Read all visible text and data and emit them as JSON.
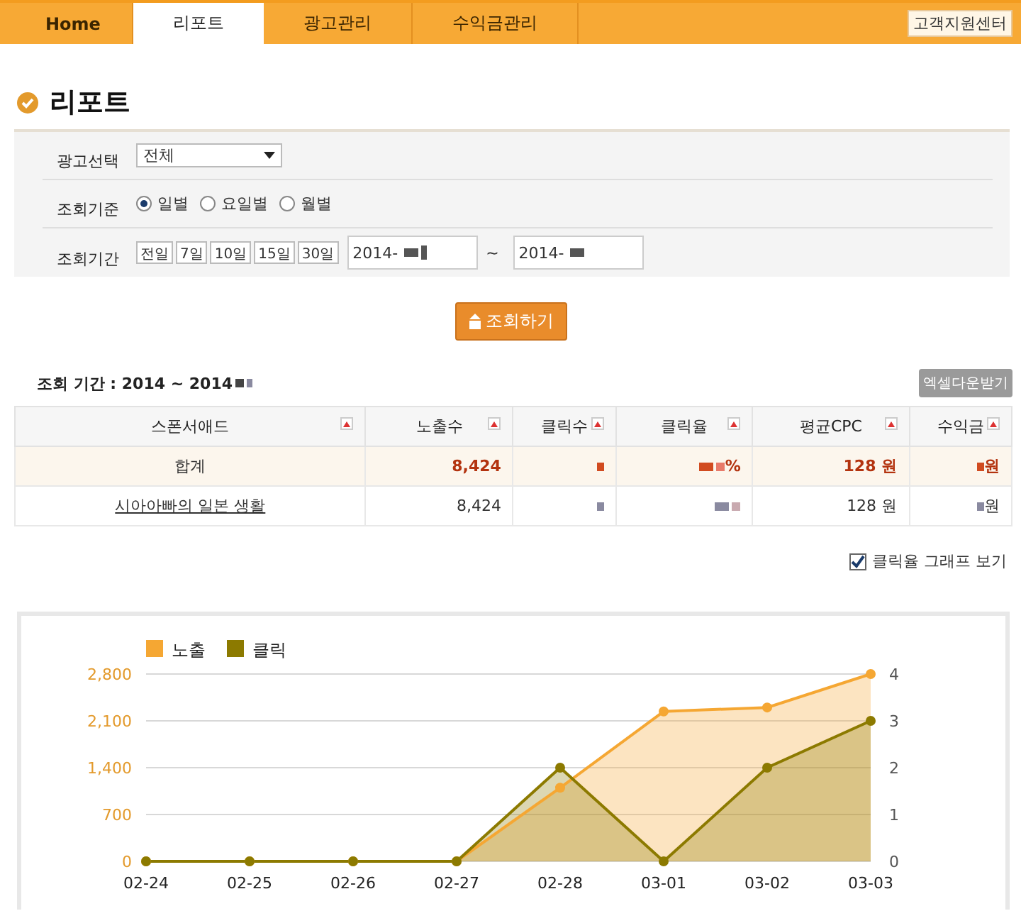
{
  "nav": {
    "tabs": [
      {
        "label": "Home",
        "selected": false
      },
      {
        "label": "리포트",
        "selected": true
      },
      {
        "label": "광고관리",
        "selected": false
      },
      {
        "label": "수익금관리",
        "selected": false
      }
    ],
    "support_button": "고객지원센터"
  },
  "title": "리포트",
  "filters": {
    "ad_select": {
      "label": "광고선택",
      "value": "전체"
    },
    "basis": {
      "label": "조회기준",
      "options": [
        {
          "label": "일별",
          "selected": true
        },
        {
          "label": "요일별",
          "selected": false
        },
        {
          "label": "월별",
          "selected": false
        }
      ]
    },
    "period": {
      "label": "조회기간",
      "presets": [
        "전일",
        "7일",
        "10일",
        "15일",
        "30일"
      ],
      "from": {
        "value": "2014-",
        "redacted": true
      },
      "separator": "~",
      "to": {
        "value": "2014-",
        "redacted": true
      }
    }
  },
  "search_button": "조회하기",
  "summary": {
    "label": "조회 기간 : 2014",
    "separator": "~ 2014",
    "redacted": true
  },
  "excel_button": "엑셀다운받기",
  "table": {
    "columns": [
      "스폰서애드",
      "노출수",
      "클릭수",
      "클릭율",
      "평균CPC",
      "수익금"
    ],
    "rows": [
      {
        "kind": "total",
        "cells": [
          {
            "text": "합계",
            "redacted": false
          },
          {
            "text": "8,424",
            "redacted": false
          },
          {
            "redacted": true
          },
          {
            "text": "%",
            "redacted": true
          },
          {
            "text": "128 원",
            "redacted": false
          },
          {
            "text": "원",
            "redacted": true
          }
        ]
      },
      {
        "kind": "link",
        "cells": [
          {
            "text": "시아아빠의 일본 생활",
            "redacted": false
          },
          {
            "text": "8,424",
            "redacted": false
          },
          {
            "redacted": true
          },
          {
            "redacted": true
          },
          {
            "text": "128 원",
            "redacted": false
          },
          {
            "text": "원",
            "redacted": true
          }
        ]
      }
    ]
  },
  "graph_toggle": {
    "label": "클릭율 그래프 보기",
    "checked": true
  },
  "chart": {
    "chart_data": {
      "type": "area",
      "categories": [
        "02-24",
        "02-25",
        "02-26",
        "02-27",
        "02-28",
        "03-01",
        "03-02",
        "03-03"
      ],
      "series": [
        {
          "name": "노출",
          "color": "#f5a733",
          "values": [
            0,
            0,
            0,
            0,
            1100,
            2240,
            2300,
            2800
          ]
        },
        {
          "name": "클릭",
          "color": "#8c7a00",
          "axis": "y2",
          "values": [
            0,
            0,
            0,
            0,
            2,
            0,
            2,
            3
          ]
        }
      ],
      "grid": true,
      "legend": true,
      "ylim": [
        0,
        2800
      ],
      "yticks": [
        {
          "value": 0,
          "label": "0"
        },
        {
          "value": 700,
          "label": "700"
        },
        {
          "value": 1400,
          "label": "1,400"
        },
        {
          "value": 2100,
          "label": "2,100"
        },
        {
          "value": 2800,
          "label": "2,800"
        }
      ],
      "y2lim": [
        0,
        4
      ],
      "y2ticks": [
        0,
        1,
        2,
        3,
        4
      ]
    }
  }
}
